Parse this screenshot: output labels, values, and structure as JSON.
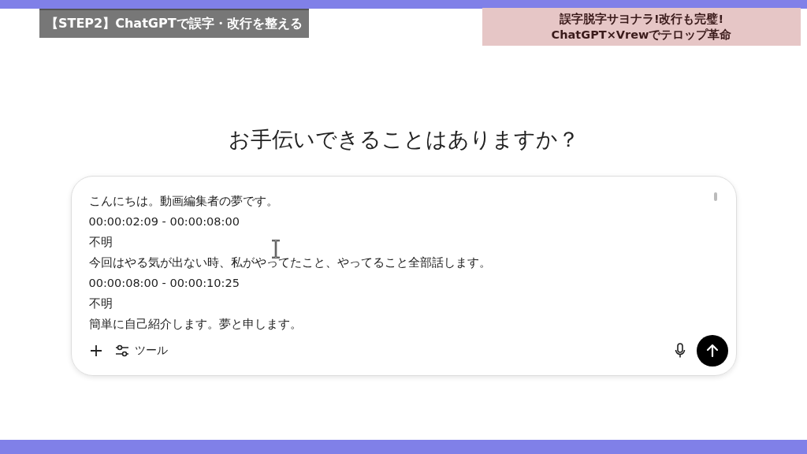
{
  "step_label": "【STEP2】ChatGPTで誤字・改行を整える",
  "headline": [
    "誤字脱字サヨナラ!改行も完璧!",
    "ChatGPT×Vrewでテロップ革命"
  ],
  "heading": "お手伝いできることはありますか？",
  "composer": {
    "lines": [
      "こんにちは。動画編集者の夢です。",
      "00:00:02:09 - 00:00:08:00",
      "不明",
      "今回はやる気が出ない時、私がやってたこと、やってること全部話します。",
      "00:00:08:00 - 00:00:10:25",
      "不明",
      "簡単に自己紹介します。夢と申します。"
    ],
    "tools_label": "ツール"
  }
}
